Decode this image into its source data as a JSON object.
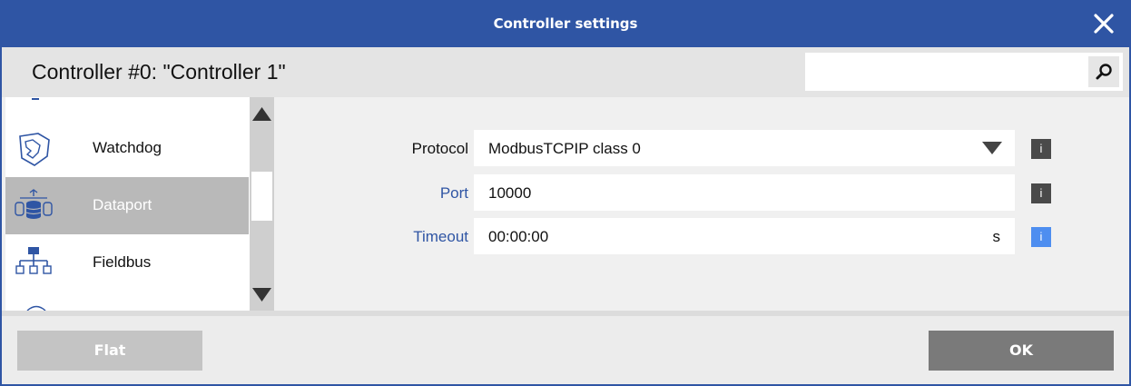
{
  "window": {
    "title": "Controller settings"
  },
  "header": {
    "controller_name": "Controller #0: \"Controller 1\"",
    "search": {
      "value": "",
      "placeholder": ""
    }
  },
  "sidebar": {
    "items": [
      {
        "label": "Watchdog",
        "icon": "watchdog-shield-icon",
        "selected": false
      },
      {
        "label": "Dataport",
        "icon": "database-stack-icon",
        "selected": true
      },
      {
        "label": "Fieldbus",
        "icon": "network-tree-icon",
        "selected": false
      }
    ]
  },
  "form": {
    "protocol": {
      "label": "Protocol",
      "value": "ModbusTCPIP class 0"
    },
    "port": {
      "label": "Port",
      "value": "10000"
    },
    "timeout": {
      "label": "Timeout",
      "value": "00:00:00",
      "unit": "s"
    },
    "info_glyph": "i"
  },
  "footer": {
    "flat_label": "Flat",
    "ok_label": "OK"
  },
  "colors": {
    "titlebar": "#2f55a4",
    "link_label": "#2f55a4",
    "selected_item": "#b9b9b9",
    "info_active": "#4e8ef0",
    "ok_button": "#7a7a7a",
    "flat_button": "#c4c4c4"
  }
}
